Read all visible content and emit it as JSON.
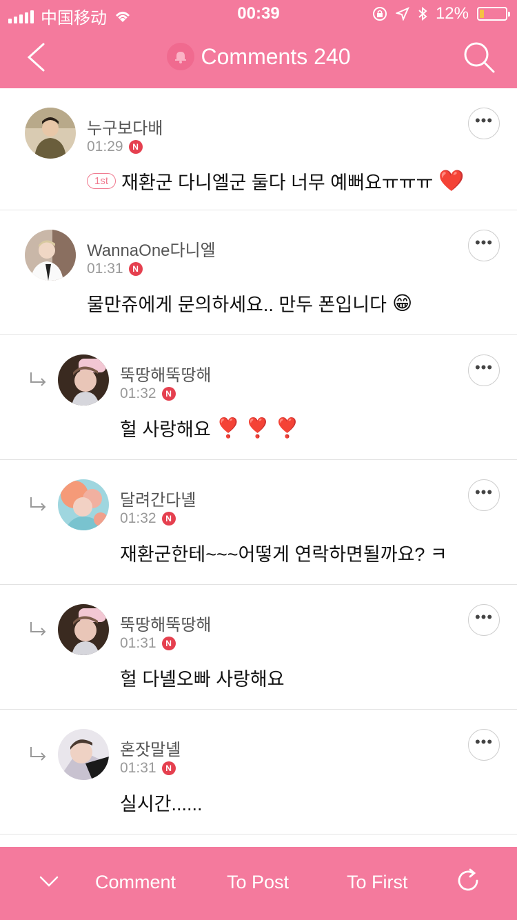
{
  "status_bar": {
    "carrier": "中国移动",
    "time": "00:39",
    "battery": "12%"
  },
  "header": {
    "title": "Comments 240"
  },
  "comments": [
    {
      "author": "누구보다배",
      "time": "01:29",
      "badge": "N",
      "rank_badge": "1st",
      "text": "재환군 다니엘군 둘다 너무 예뻐요ㅠㅠㅠ",
      "emoji": "❤️",
      "is_reply": false
    },
    {
      "author": "WannaOne다니엘",
      "time": "01:31",
      "badge": "N",
      "text": "물만쥬에게 문의하세요.. 만두 폰입니다",
      "emoji": "😁",
      "is_reply": false
    },
    {
      "author": "뚝땅해뚝땅해",
      "time": "01:32",
      "badge": "N",
      "text": "헐 사랑해요",
      "emoji": "❣️ ❣️ ❣️",
      "is_reply": true
    },
    {
      "author": "달려간다녤",
      "time": "01:32",
      "badge": "N",
      "text": "재환군한테~~~어떻게 연락하면될까요? ㅋ",
      "is_reply": true
    },
    {
      "author": "뚝땅해뚝땅해",
      "time": "01:31",
      "badge": "N",
      "text": "헐 다녤오빠 사랑해요",
      "is_reply": true
    },
    {
      "author": "혼잣말녤",
      "time": "01:31",
      "badge": "N",
      "text": "실시간......",
      "is_reply": true
    }
  ],
  "more_label": "•••",
  "footer": {
    "comment": "Comment",
    "to_post": "To Post",
    "to_first": "To First"
  },
  "colors": {
    "accent": "#f47a9d",
    "badge": "#e5404f"
  }
}
